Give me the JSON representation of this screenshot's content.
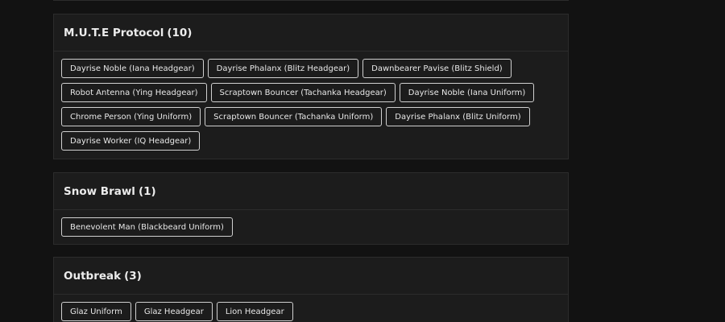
{
  "sections": [
    {
      "title": "M.U.T.E Protocol",
      "count": "(10)",
      "items": [
        "Dayrise Noble (Iana Headgear)",
        "Dayrise Phalanx (Blitz Headgear)",
        "Dawnbearer Pavise (Blitz Shield)",
        "Robot Antenna (Ying Headgear)",
        "Scraptown Bouncer (Tachanka Headgear)",
        "Dayrise Noble (Iana Uniform)",
        "Chrome Person (Ying Uniform)",
        "Scraptown Bouncer (Tachanka Uniform)",
        "Dayrise Phalanx (Blitz Uniform)",
        "Dayrise Worker (IQ Headgear)"
      ]
    },
    {
      "title": "Snow Brawl",
      "count": "(1)",
      "items": [
        "Benevolent Man (Blackbeard Uniform)"
      ]
    },
    {
      "title": "Outbreak",
      "count": "(3)",
      "items": [
        "Glaz Uniform",
        "Glaz Headgear",
        "Lion Headgear"
      ]
    }
  ]
}
